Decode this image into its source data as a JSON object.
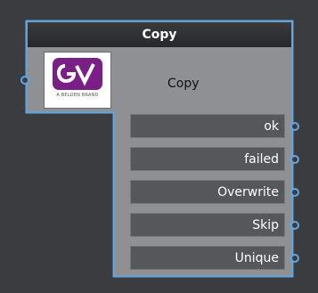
{
  "node": {
    "title": "Copy",
    "label": "Copy",
    "logo": {
      "icon": "gv-logo-icon",
      "tagline": "A BELDEN BRAND"
    },
    "outputs": [
      {
        "label": "ok"
      },
      {
        "label": "failed"
      },
      {
        "label": "Overwrite"
      },
      {
        "label": "Skip"
      },
      {
        "label": "Unique"
      }
    ]
  },
  "colors": {
    "canvas": "#3a3c40",
    "border": "#5fa7e6",
    "node_body": "#8e9094",
    "title_bar": "#2b2c2f",
    "port_bg": "#55575b",
    "logo_purple": "#7a1f86"
  }
}
